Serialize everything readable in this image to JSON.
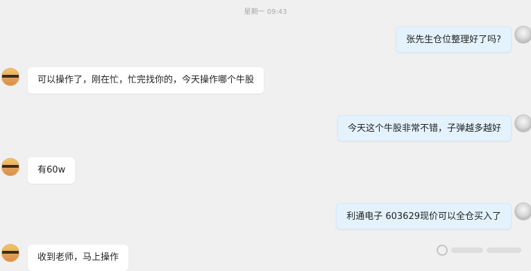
{
  "chat": {
    "timestamp": "星期一 09:43",
    "messages": [
      {
        "sender": "self",
        "text": "张先生仓位整理好了吗?"
      },
      {
        "sender": "contact",
        "text": "可以操作了，刚在忙，忙完找你的，今天操作哪个牛股"
      },
      {
        "sender": "self",
        "text": "今天这个牛股非常不错，子弹越多越好"
      },
      {
        "sender": "contact",
        "text": "有60w"
      },
      {
        "sender": "self",
        "text": "利通电子 603629现价可以全仓买入了"
      },
      {
        "sender": "contact",
        "text": "收到老师，马上操作"
      }
    ]
  },
  "colors": {
    "background": "#f0f0f0",
    "incoming_bubble": "#ffffff",
    "outgoing_bubble": "#e3f2fc",
    "timestamp_text": "#a8a8a8"
  },
  "icons": {
    "contact_avatar": "sunset-avatar-icon",
    "self_avatar": "gray-portrait-avatar-icon",
    "watermark": "weibo-watermark-icon"
  }
}
